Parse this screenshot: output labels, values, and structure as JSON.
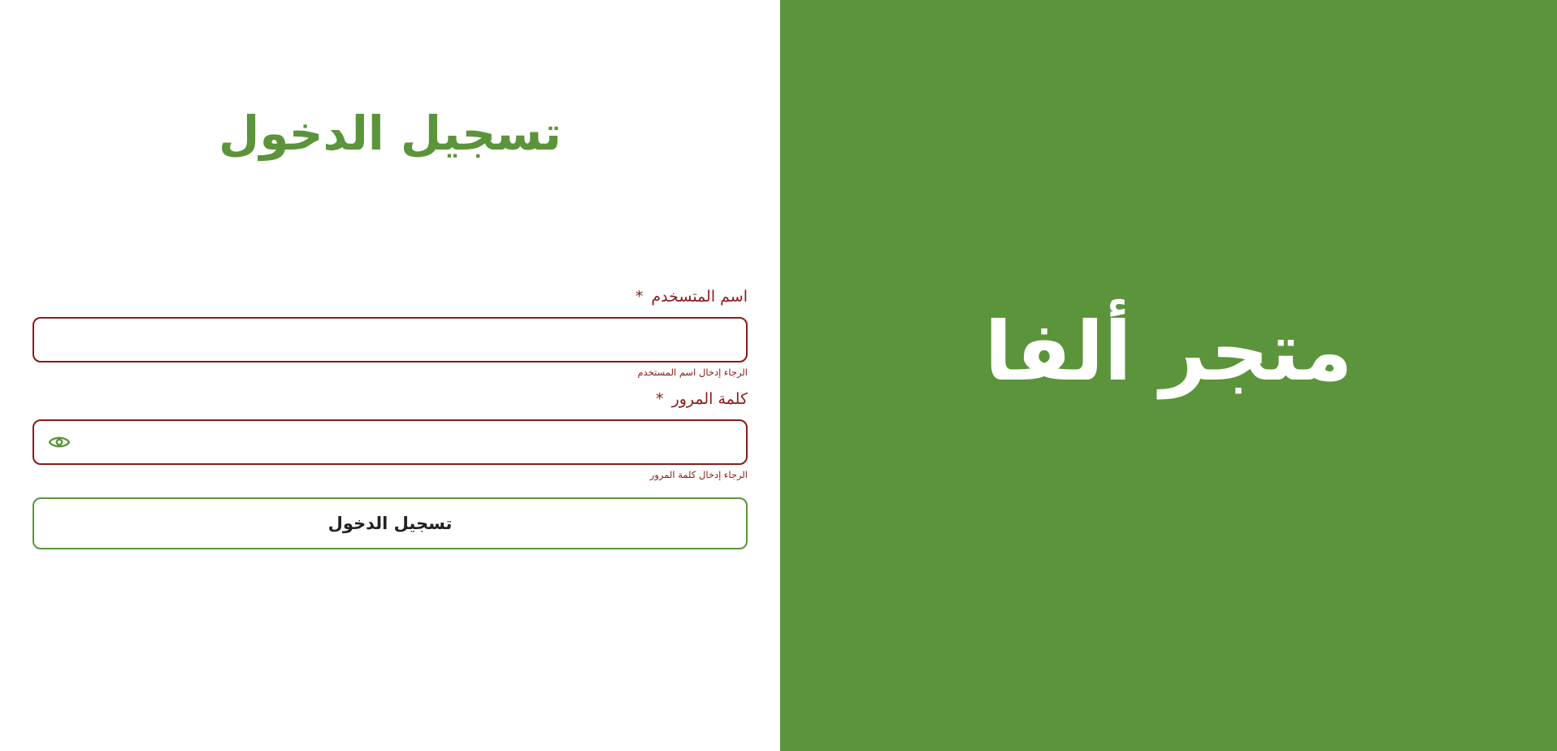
{
  "brand": {
    "name": "متجر ألفا"
  },
  "login": {
    "title": "تسجيل الدخول",
    "username": {
      "label": "اسم المتسخدم",
      "required_mark": "*",
      "value": "",
      "helper": "الرجاء إدخال اسم المستخدم"
    },
    "password": {
      "label": "كلمة المرور",
      "required_mark": "*",
      "value": "",
      "helper": "الرجاء إدخال كلمة المرور",
      "toggle_icon": "eye-icon"
    },
    "submit_label": "تسجيل الدخول"
  },
  "colors": {
    "brand_green": "#5b943b",
    "error_red": "#8b1a1a",
    "background": "#ffffff"
  }
}
